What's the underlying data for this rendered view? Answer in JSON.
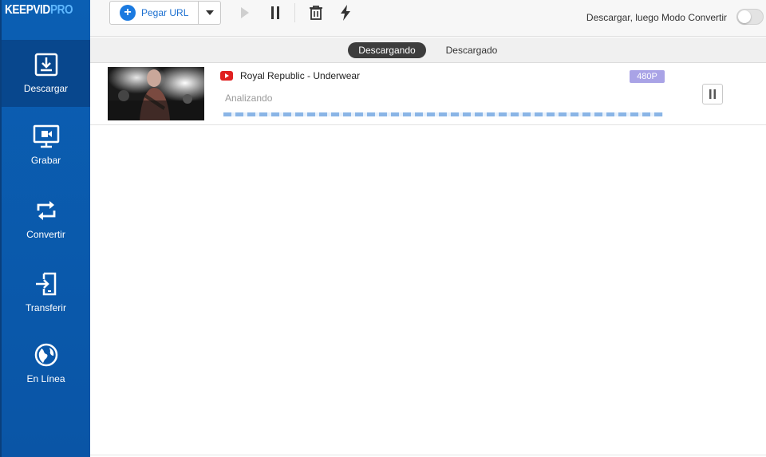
{
  "app": {
    "brand_main": "KEEPVID",
    "brand_sub": "PRO"
  },
  "sidebar": {
    "items": [
      {
        "label": "Descargar",
        "icon": "download-icon",
        "active": true
      },
      {
        "label": "Grabar",
        "icon": "record-screen-icon",
        "active": false
      },
      {
        "label": "Convertir",
        "icon": "convert-icon",
        "active": false
      },
      {
        "label": "Transferir",
        "icon": "transfer-icon",
        "active": false
      },
      {
        "label": "En Línea",
        "icon": "globe-icon",
        "active": false
      }
    ]
  },
  "toolbar": {
    "paste_label": "Pegar URL",
    "mode_label": "Descargar, luego Modo Convertir",
    "mode_enabled": false
  },
  "tabs": [
    {
      "label": "Descargando",
      "active": true
    },
    {
      "label": "Descargado",
      "active": false
    }
  ],
  "downloads": [
    {
      "title": "Royal Republic - Underwear",
      "source_icon": "youtube-icon",
      "status": "Analizando",
      "quality": "480P"
    }
  ],
  "colors": {
    "sidebar": "#0b5fb3",
    "sidebar_active": "#08478d",
    "accent": "#1b7ae0",
    "quality_badge": "#a9a3e6",
    "youtube": "#e02020"
  }
}
